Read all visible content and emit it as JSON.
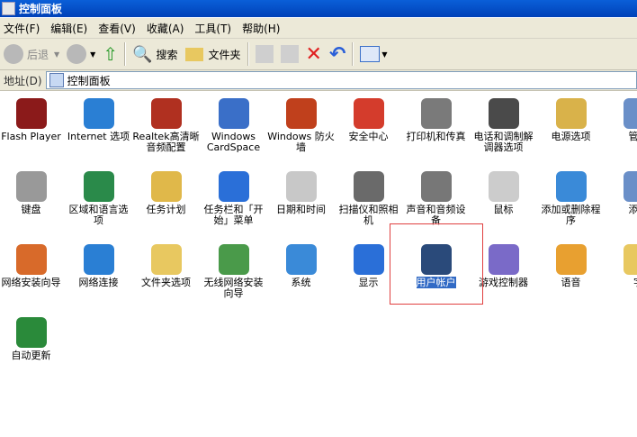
{
  "window": {
    "title": "控制面板"
  },
  "menu": [
    "文件(F)",
    "编辑(E)",
    "查看(V)",
    "收藏(A)",
    "工具(T)",
    "帮助(H)"
  ],
  "toolbar": {
    "back_label": "后退",
    "search_label": "搜索",
    "folders_label": "文件夹"
  },
  "address": {
    "label": "地址(D)",
    "value": "控制面板"
  },
  "items": [
    {
      "label": "Flash Player",
      "icon": "flash-icon",
      "color": "#8b1a1a"
    },
    {
      "label": "Internet 选项",
      "icon": "globe-icon",
      "color": "#2a7fd4"
    },
    {
      "label": "Realtek高清晰音频配置",
      "icon": "speaker-icon",
      "color": "#b03020"
    },
    {
      "label": "Windows CardSpace",
      "icon": "cardspace-icon",
      "color": "#3a6fc8"
    },
    {
      "label": "Windows 防火墙",
      "icon": "firewall-icon",
      "color": "#c0401c"
    },
    {
      "label": "安全中心",
      "icon": "shield-icon",
      "color": "#d43c2c"
    },
    {
      "label": "打印机和传真",
      "icon": "printer-icon",
      "color": "#7a7a7a"
    },
    {
      "label": "电话和调制解调器选项",
      "icon": "phone-icon",
      "color": "#4a4a4a"
    },
    {
      "label": "电源选项",
      "icon": "power-icon",
      "color": "#d9b24a"
    },
    {
      "label": "管理",
      "icon": "admin-icon",
      "color": "#6a8fc8"
    },
    {
      "label": "键盘",
      "icon": "keyboard-icon",
      "color": "#999999"
    },
    {
      "label": "区域和语言选项",
      "icon": "region-globe-icon",
      "color": "#2a8a4a"
    },
    {
      "label": "任务计划",
      "icon": "scheduled-tasks-icon",
      "color": "#e0b84a"
    },
    {
      "label": "任务栏和「开始」菜单",
      "icon": "taskbar-icon",
      "color": "#2a6fd8"
    },
    {
      "label": "日期和时间",
      "icon": "clock-icon",
      "color": "#c8c8c8"
    },
    {
      "label": "扫描仪和照相机",
      "icon": "scanner-icon",
      "color": "#6a6a6a"
    },
    {
      "label": "声音和音频设备",
      "icon": "sound-icon",
      "color": "#777777"
    },
    {
      "label": "鼠标",
      "icon": "mouse-icon",
      "color": "#cccccc"
    },
    {
      "label": "添加或删除程序",
      "icon": "add-remove-icon",
      "color": "#3a8ad8"
    },
    {
      "label": "添加",
      "icon": "add-hardware-icon",
      "color": "#6a8fc8"
    },
    {
      "label": "网络安装向导",
      "icon": "network-setup-icon",
      "color": "#d86a2a"
    },
    {
      "label": "网络连接",
      "icon": "network-globe-icon",
      "color": "#2a7fd4"
    },
    {
      "label": "文件夹选项",
      "icon": "folder-options-icon",
      "color": "#e8c860"
    },
    {
      "label": "无线网络安装向导",
      "icon": "wireless-icon",
      "color": "#4a9a4a"
    },
    {
      "label": "系统",
      "icon": "system-icon",
      "color": "#3a8ad8"
    },
    {
      "label": "显示",
      "icon": "display-icon",
      "color": "#2a6fd8"
    },
    {
      "label": "用户帐户",
      "icon": "user-accounts-icon",
      "color": "#2a4a7a",
      "selected": true
    },
    {
      "label": "游戏控制器",
      "icon": "gamepad-icon",
      "color": "#7a6ac8"
    },
    {
      "label": "语音",
      "icon": "speech-icon",
      "color": "#e8a030"
    },
    {
      "label": "字",
      "icon": "fonts-folder-icon",
      "color": "#e8c860"
    },
    {
      "label": "自动更新",
      "icon": "windows-update-icon",
      "color": "#2a8a3a"
    }
  ]
}
